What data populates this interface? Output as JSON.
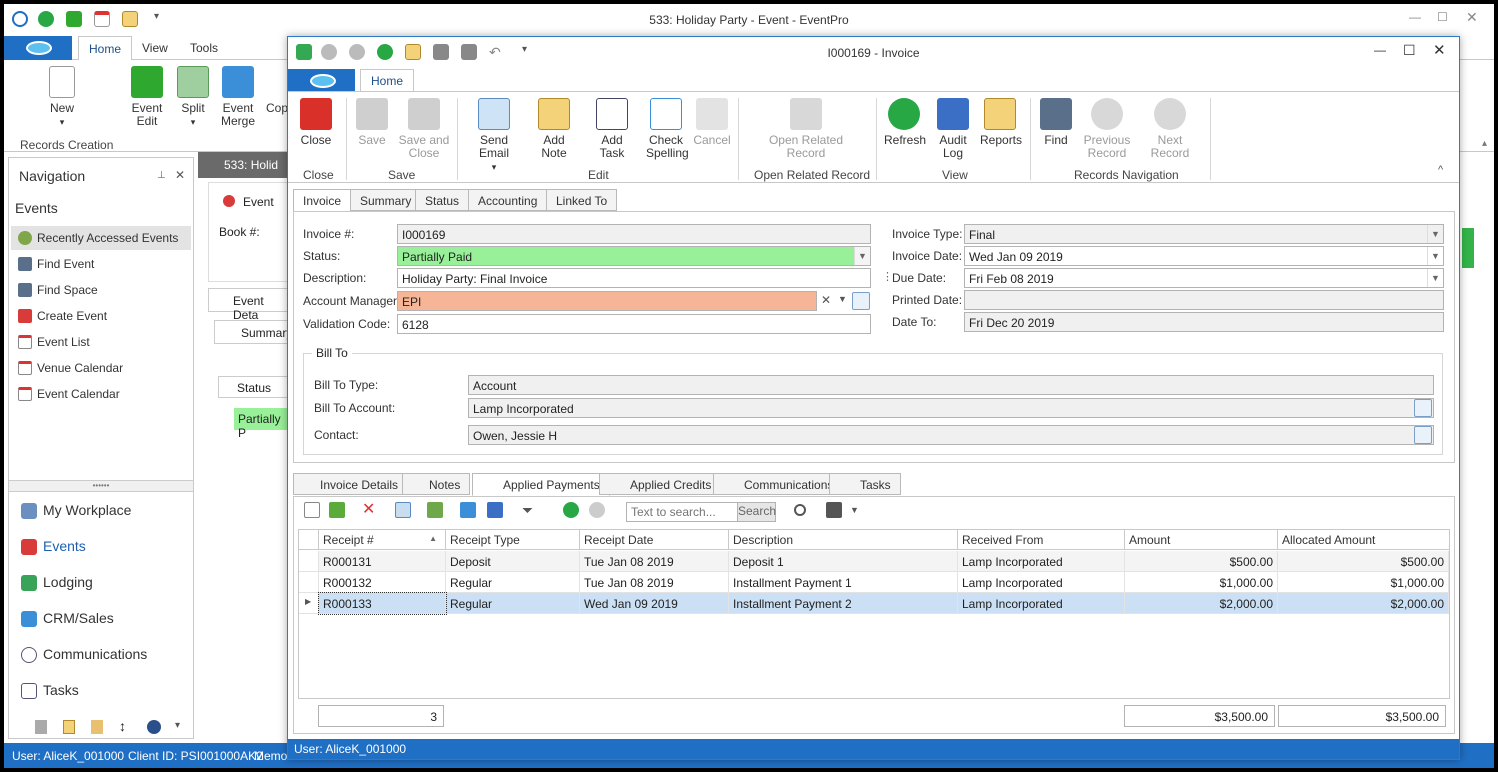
{
  "main": {
    "title": "533: Holiday Party - Event - EventPro",
    "ribbon_tabs": [
      "Home",
      "View",
      "Tools"
    ],
    "buttons": {
      "new": "New",
      "event_edit": "Event Edit",
      "split": "Split",
      "event_merge": "Event Merge",
      "copy": "Cop"
    },
    "group_records": "Records Creation"
  },
  "nav": {
    "title": "Navigation",
    "section": "Events",
    "items": [
      "Recently Accessed Events",
      "Find Event",
      "Find Space",
      "Create Event",
      "Event List",
      "Venue Calendar",
      "Event Calendar"
    ],
    "big": [
      "My Workplace",
      "Events",
      "Lodging",
      "CRM/Sales",
      "Communications",
      "Tasks"
    ]
  },
  "bg": {
    "tab": "533: Holid",
    "event": "Event",
    "book": "Book #:",
    "event_details": "Event Deta",
    "summary": "Summary",
    "status_col": "Status",
    "status_val": "Partially P"
  },
  "status": {
    "user": "User: AliceK_001000",
    "client": "Client ID: PSI001000AK2",
    "memo": "Memor"
  },
  "inv": {
    "title": "I000169 - Invoice",
    "home_tab": "Home",
    "rb": {
      "close": "Close",
      "save": "Save",
      "save_close": "Save and Close",
      "send_email": "Send Email",
      "add_note": "Add Note",
      "add_task": "Add Task",
      "check_spelling": "Check Spelling",
      "cancel": "Cancel",
      "open_related": "Open Related Record",
      "refresh": "Refresh",
      "audit_log": "Audit Log",
      "reports": "Reports",
      "find": "Find",
      "prev": "Previous Record",
      "next": "Next Record"
    },
    "groups": {
      "close": "Close",
      "save": "Save",
      "edit": "Edit",
      "open_related": "Open Related Record",
      "view": "View",
      "nav": "Records Navigation"
    },
    "tabs": [
      "Invoice",
      "Summary",
      "Status",
      "Accounting",
      "Linked To"
    ],
    "form": {
      "invoice_no_label": "Invoice #:",
      "invoice_no": "I000169",
      "status_label": "Status:",
      "status": "Partially Paid",
      "desc_label": "Description:",
      "desc": "Holiday Party: Final Invoice",
      "am_label": "Account Manager:",
      "am": "EPI",
      "vc_label": "Validation Code:",
      "vc": "6128",
      "type_label": "Invoice Type:",
      "type": "Final",
      "date_label": "Invoice Date:",
      "date": "Wed Jan 09 2019",
      "due_label": "Due Date:",
      "due": "Fri Feb 08 2019",
      "printed_label": "Printed Date:",
      "printed": "",
      "dateto_label": "Date To:",
      "dateto": "Fri Dec 20 2019",
      "billto": "Bill To",
      "bt_type_label": "Bill To Type:",
      "bt_type": "Account",
      "bt_acct_label": "Bill To Account:",
      "bt_acct": "Lamp Incorporated",
      "contact_label": "Contact:",
      "contact": "Owen, Jessie H"
    },
    "lower_tabs": [
      "Invoice Details",
      "Notes",
      "Applied Payments",
      "Applied Credits",
      "Communications",
      "Tasks"
    ],
    "search_placeholder": "Text to search...",
    "search_btn": "Search",
    "columns": [
      "Receipt #",
      "Receipt Type",
      "Receipt Date",
      "Description",
      "Received From",
      "Amount",
      "Allocated Amount"
    ],
    "rows": [
      [
        "R000131",
        "Deposit",
        "Tue Jan 08 2019",
        "Deposit 1",
        "Lamp Incorporated",
        "$500.00",
        "$500.00"
      ],
      [
        "R000132",
        "Regular",
        "Tue Jan 08 2019",
        "Installment Payment 1",
        "Lamp Incorporated",
        "$1,000.00",
        "$1,000.00"
      ],
      [
        "R000133",
        "Regular",
        "Wed Jan 09 2019",
        "Installment Payment 2",
        "Lamp Incorporated",
        "$2,000.00",
        "$2,000.00"
      ]
    ],
    "footer": {
      "count": "3",
      "amount": "$3,500.00",
      "allocated": "$3,500.00"
    },
    "status": "User: AliceK_001000"
  },
  "colors": {
    "accent": "#1f6fc5",
    "status_green": "#98f098",
    "am_orange": "#f5b596",
    "selected_row": "#cce0f5"
  }
}
